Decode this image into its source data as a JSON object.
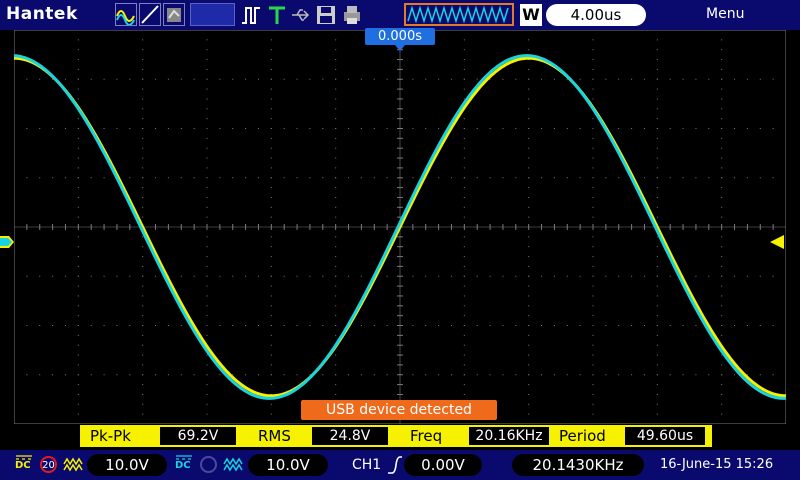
{
  "brand": "Hantek",
  "timebase": {
    "mode": "W",
    "value": "4.00us"
  },
  "menu_label": "Menu",
  "trigger_position": "0.000s",
  "colors": {
    "ch1": "#f5f100",
    "ch2": "#19d4e0",
    "frame": "#0a0a6e",
    "grid": "#7a7a7a",
    "toast": "#f06a1c",
    "trigger_flag": "#1f6fe0"
  },
  "icons": [
    "waveform-type-icon",
    "edge-line-icon",
    "roll-mode-icon",
    "pulse-icon",
    "trigger-t-icon",
    "usb-icon",
    "save-icon",
    "print-icon"
  ],
  "waveform": {
    "type": "sine",
    "cycles_visible": 1.5,
    "amplitude_fraction": 0.87
  },
  "notification": "USB device detected",
  "measurements": [
    {
      "label": "Pk-Pk",
      "value": "69.2V"
    },
    {
      "label": "RMS",
      "value": "24.8V"
    },
    {
      "label": "Freq",
      "value": "20.16KHz"
    },
    {
      "label": "Period",
      "value": "49.60us"
    }
  ],
  "channels": [
    {
      "name": "CH1",
      "coupling": "DC",
      "bw_limit": "20",
      "scale": "10.0V",
      "color": "#f5f100"
    },
    {
      "name": "CH2",
      "coupling": "DC",
      "bw_limit": "",
      "scale": "10.0V",
      "color": "#19d4e0"
    }
  ],
  "trigger": {
    "source": "CH1",
    "level": "0.00V"
  },
  "frequency_counter": "20.1430KHz",
  "datetime": "16-June-15 15:26"
}
